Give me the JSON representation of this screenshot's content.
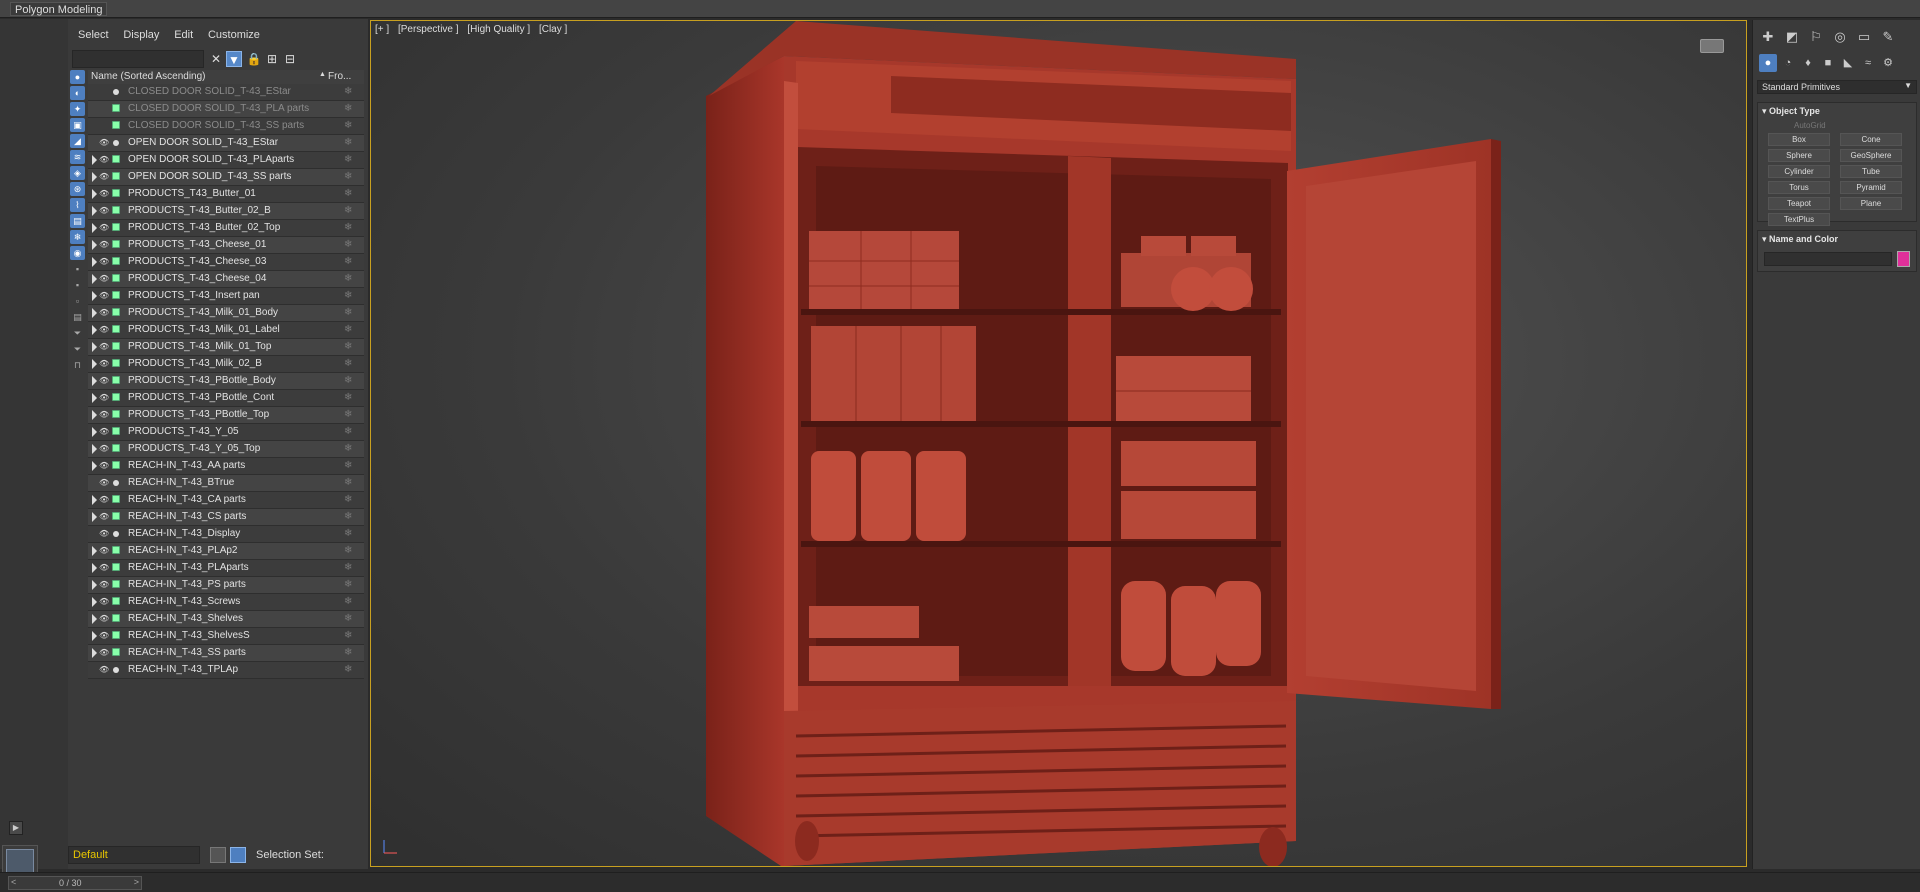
{
  "ribbon": {
    "tab": "Polygon Modeling"
  },
  "explorer": {
    "menu": [
      "Select",
      "Display",
      "Edit",
      "Customize"
    ],
    "header": {
      "name": "Name (Sorted Ascending)",
      "frozen": "Fro..."
    },
    "rows": [
      {
        "label": "CLOSED DOOR SOLID_T-43_EStar",
        "dim": true,
        "expand": false,
        "type": "dot"
      },
      {
        "label": "CLOSED DOOR SOLID_T-43_PLA parts",
        "dim": true,
        "expand": false,
        "type": "geo"
      },
      {
        "label": "CLOSED DOOR SOLID_T-43_SS parts",
        "dim": true,
        "expand": false,
        "type": "geo"
      },
      {
        "label": "OPEN DOOR SOLID_T-43_EStar",
        "dim": false,
        "expand": false,
        "type": "dot"
      },
      {
        "label": "OPEN DOOR SOLID_T-43_PLAparts",
        "dim": false,
        "expand": true,
        "type": "geo"
      },
      {
        "label": "OPEN DOOR SOLID_T-43_SS parts",
        "dim": false,
        "expand": true,
        "type": "geo"
      },
      {
        "label": "PRODUCTS_T43_Butter_01",
        "dim": false,
        "expand": true,
        "type": "geo"
      },
      {
        "label": "PRODUCTS_T-43_Butter_02_B",
        "dim": false,
        "expand": true,
        "type": "geo"
      },
      {
        "label": "PRODUCTS_T-43_Butter_02_Top",
        "dim": false,
        "expand": true,
        "type": "geo"
      },
      {
        "label": "PRODUCTS_T-43_Cheese_01",
        "dim": false,
        "expand": true,
        "type": "geo"
      },
      {
        "label": "PRODUCTS_T-43_Cheese_03",
        "dim": false,
        "expand": true,
        "type": "geo"
      },
      {
        "label": "PRODUCTS_T-43_Cheese_04",
        "dim": false,
        "expand": true,
        "type": "geo"
      },
      {
        "label": "PRODUCTS_T-43_Insert pan",
        "dim": false,
        "expand": true,
        "type": "geo"
      },
      {
        "label": "PRODUCTS_T-43_Milk_01_Body",
        "dim": false,
        "expand": true,
        "type": "geo"
      },
      {
        "label": "PRODUCTS_T-43_Milk_01_Label",
        "dim": false,
        "expand": true,
        "type": "geo"
      },
      {
        "label": "PRODUCTS_T-43_Milk_01_Top",
        "dim": false,
        "expand": true,
        "type": "geo"
      },
      {
        "label": "PRODUCTS_T-43_Milk_02_B",
        "dim": false,
        "expand": true,
        "type": "geo"
      },
      {
        "label": "PRODUCTS_T-43_PBottle_Body",
        "dim": false,
        "expand": true,
        "type": "geo"
      },
      {
        "label": "PRODUCTS_T-43_PBottle_Cont",
        "dim": false,
        "expand": true,
        "type": "geo"
      },
      {
        "label": "PRODUCTS_T-43_PBottle_Top",
        "dim": false,
        "expand": true,
        "type": "geo"
      },
      {
        "label": "PRODUCTS_T-43_Y_05",
        "dim": false,
        "expand": true,
        "type": "geo"
      },
      {
        "label": "PRODUCTS_T-43_Y_05_Top",
        "dim": false,
        "expand": true,
        "type": "geo"
      },
      {
        "label": "REACH-IN_T-43_AA parts",
        "dim": false,
        "expand": true,
        "type": "geo"
      },
      {
        "label": "REACH-IN_T-43_BTrue",
        "dim": false,
        "expand": false,
        "type": "dot"
      },
      {
        "label": "REACH-IN_T-43_CA parts",
        "dim": false,
        "expand": true,
        "type": "geo"
      },
      {
        "label": "REACH-IN_T-43_CS parts",
        "dim": false,
        "expand": true,
        "type": "geo"
      },
      {
        "label": "REACH-IN_T-43_Display",
        "dim": false,
        "expand": false,
        "type": "dot"
      },
      {
        "label": "REACH-IN_T-43_PLAp2",
        "dim": false,
        "expand": true,
        "type": "geo"
      },
      {
        "label": "REACH-IN_T-43_PLAparts",
        "dim": false,
        "expand": true,
        "type": "geo"
      },
      {
        "label": "REACH-IN_T-43_PS parts",
        "dim": false,
        "expand": true,
        "type": "geo"
      },
      {
        "label": "REACH-IN_T-43_Screws",
        "dim": false,
        "expand": true,
        "type": "geo"
      },
      {
        "label": "REACH-IN_T-43_Shelves",
        "dim": false,
        "expand": true,
        "type": "geo"
      },
      {
        "label": "REACH-IN_T-43_ShelvesS",
        "dim": false,
        "expand": true,
        "type": "geo"
      },
      {
        "label": "REACH-IN_T-43_SS parts",
        "dim": false,
        "expand": true,
        "type": "geo"
      },
      {
        "label": "REACH-IN_T-43_TPLAp",
        "dim": false,
        "expand": false,
        "type": "dot"
      }
    ],
    "layer": "Default",
    "selection_set_label": "Selection Set:"
  },
  "viewport": {
    "labels": [
      "[+ ]",
      "[Perspective ]",
      "[High Quality ]",
      "[Clay ]"
    ],
    "model_color": "#a8382b"
  },
  "command_panel": {
    "dropdown": "Standard Primitives",
    "object_type_title": "Object Type",
    "autogrid": "AutoGrid",
    "buttons": [
      "Box",
      "Cone",
      "Sphere",
      "GeoSphere",
      "Cylinder",
      "Tube",
      "Torus",
      "Pyramid",
      "Teapot",
      "Plane",
      "TextPlus"
    ],
    "name_color_title": "Name and Color",
    "swatch_color": "#e0309a"
  },
  "timeline": {
    "frame": "0 / 30",
    "prev": "<",
    "next": ">"
  }
}
